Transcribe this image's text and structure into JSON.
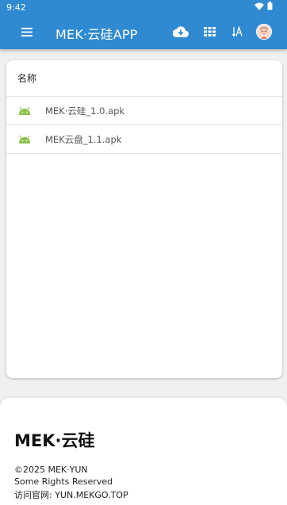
{
  "status": {
    "time": "9:42"
  },
  "appbar": {
    "title": "MEK·云硅APP",
    "actions": [
      "cloud-download-icon",
      "grid-view-icon",
      "sort-az-icon",
      "avatar"
    ]
  },
  "list": {
    "header": "名称",
    "files": [
      {
        "name": "MEK·云硅_1.0.apk",
        "icon": "android-icon"
      },
      {
        "name": "MEK云盘_1.1.apk",
        "icon": "android-icon"
      }
    ]
  },
  "footer": {
    "brand": "MEK·云硅",
    "copyright": "©2025 MEK·YUN",
    "rights": "Some Rights Reserved",
    "site": "访问官网: YUN.MEKGO.TOP"
  },
  "colors": {
    "primary": "#2f8ad1",
    "android": "#8bc34a"
  }
}
